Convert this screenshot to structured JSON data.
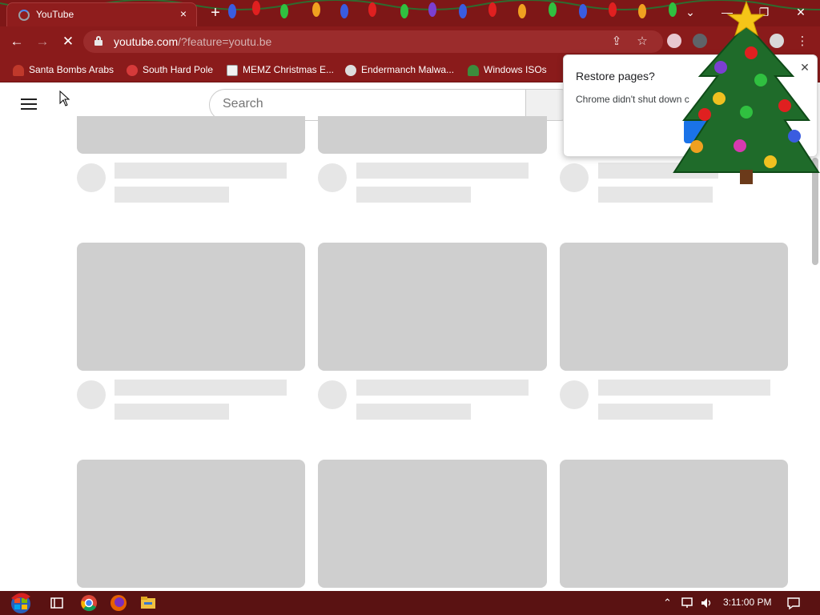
{
  "browser": {
    "tab": {
      "title": "YouTube",
      "close_icon": "×"
    },
    "new_tab_icon": "+",
    "window_controls": {
      "dropdown": "⌄",
      "minimize": "—",
      "restore": "❐",
      "close": "✕"
    },
    "toolbar": {
      "back_icon": "←",
      "forward_icon": "→",
      "reload_icon": "✕",
      "url_host": "youtube.com",
      "url_path": "/?feature=youtu.be",
      "share_icon": "⇪",
      "star_icon": "☆",
      "menu_icon": "⋮"
    },
    "bookmarks": [
      {
        "label": "Santa Bombs Arabs",
        "icon": "santa-icon"
      },
      {
        "label": "South Hard Pole",
        "icon": "snowflake-icon"
      },
      {
        "label": "MEMZ Christmas E...",
        "icon": "memz-icon"
      },
      {
        "label": "Endermanch Malwa...",
        "icon": "skull-icon"
      },
      {
        "label": "Windows ISOs",
        "icon": "tree-icon"
      }
    ]
  },
  "youtube": {
    "search_placeholder": "Search"
  },
  "popup": {
    "title": "Restore pages?",
    "message": "Chrome didn't shut down c",
    "close_icon": "✕"
  },
  "taskbar": {
    "time": "3:11:00 PM"
  },
  "colors": {
    "chrome_frame": "#8a1b1b",
    "skeleton": "#cfcfcf",
    "skeleton_light": "#e6e6e6",
    "accent_blue": "#1a73e8",
    "taskbar": "#5a1212"
  }
}
